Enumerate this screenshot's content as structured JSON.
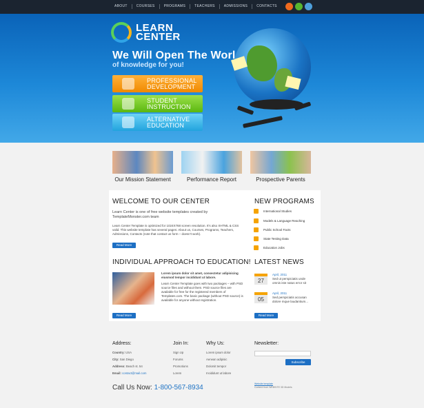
{
  "nav": [
    "ABOUT",
    "COURSES",
    "PROGRAMS",
    "TEACHERS",
    "ADMISSIONS",
    "CONTACTS"
  ],
  "social_icons": [
    "facebook-icon",
    "rss-icon",
    "twitter-icon"
  ],
  "logo": {
    "line1": "LEARN",
    "line2": "CENTER"
  },
  "hero": {
    "title": "We Will Open The World",
    "subtitle": "of knowledge for you!"
  },
  "hero_buttons": [
    {
      "line1": "PROFESSIONAL",
      "line2": "DEVELOPMENT"
    },
    {
      "line1": "STUDENT",
      "line2": "INSTRUCTION"
    },
    {
      "line1": "ALTERNATIVE",
      "line2": "EDUCATION"
    }
  ],
  "thumbnails": [
    {
      "caption": "Our Mission Statement"
    },
    {
      "caption": "Performance Report"
    },
    {
      "caption": "Prospective Parents"
    }
  ],
  "welcome": {
    "title": "WELCOME TO OUR CENTER",
    "lead": "Learn Center is one of free website templates created by TemplateMonster.com team",
    "text": "Learn Center Template is optimized for 1024X768 screen resolution. It's also XHTML & CSS valid. This website template has several pages: About us, Courses, Programs, Teachers, Admissions, Contacts (note that contact us form – doesn't work).",
    "read_more": "Read More"
  },
  "approach": {
    "title": "INDIVIDUAL APPROACH TO EDUCATION!",
    "lead": "Lorem ipsum dolor sit amet, consectetur adipisicing eiusmod tempor incididunt ut labore.",
    "text": "Learn Center Template goes with two packages – with PSD source files and without them. PSD source files are available for free for the registered members of Templates.com. The basic package (without PSD source) is available for anyone without registration.",
    "read_more": "Read More"
  },
  "programs": {
    "title": "NEW PROGRAMS",
    "items": [
      "International Studies",
      "Models & Language Reaching",
      "Public School Facts",
      "State Testing Data",
      "Education Jobs"
    ]
  },
  "news": {
    "title": "LATEST NEWS",
    "items": [
      {
        "day": "27",
        "date": "April, 2011",
        "text": "Sed ut perspiciatis unde omnis iste natus error sit"
      },
      {
        "day": "05",
        "date": "April, 2011",
        "text": "Sed perspiciatis accusan dolore mque laudantium..."
      }
    ],
    "read_more": "Read More"
  },
  "footer": {
    "address_title": "Address:",
    "address": [
      {
        "label": "Country:",
        "value": "USA"
      },
      {
        "label": "City:",
        "value": "San Diego"
      },
      {
        "label": "Address:",
        "value": "Beach st. 54"
      },
      {
        "label": "Email:",
        "value": "contact@mail.com"
      }
    ],
    "join_title": "Join In:",
    "join": [
      "Sign Up",
      "Forums",
      "Promotions",
      "Lorem"
    ],
    "why_title": "Why Us:",
    "why": [
      "Lorem ipsum dolor",
      "Aenean adipisic",
      "Dolorsit tempor",
      "Incididunt ut labore"
    ],
    "newsletter_title": "Newsletter:",
    "subscribe": "Subscribe",
    "phone_label": "Call Us Now:",
    "phone": "1-800-567-8934",
    "copyright": [
      "Website template",
      "Content from WEBSITE 3D Models"
    ]
  }
}
